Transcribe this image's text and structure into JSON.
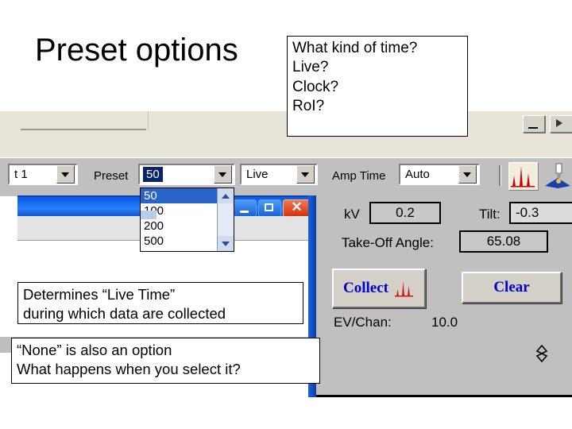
{
  "slide": {
    "title": "Preset options"
  },
  "callouts": {
    "time_question": {
      "lines": [
        "What kind of time?",
        "Live?",
        "Clock?",
        "RoI?"
      ]
    },
    "live_time": {
      "lines": [
        "Determines “Live Time”",
        " during which data are collected"
      ]
    },
    "none_option": {
      "lines": [
        "“None” is also an option",
        "What happens when you select it?"
      ]
    }
  },
  "app": {
    "toolbar": {
      "set_combo_value": "t 1",
      "preset_label": "Preset",
      "preset_value": "50",
      "time_mode_value": "Live",
      "amp_time_label": "Amp Time",
      "amp_time_value": "Auto",
      "spectrum_icon": "spectrum-icon",
      "probe_icon": "probe-icon"
    },
    "preset_dropdown": {
      "options": [
        "50",
        "100",
        "200",
        "500"
      ],
      "selected": "50"
    },
    "window_controls": {
      "minimize": "minimize-icon",
      "maximize": "maximize-icon",
      "close": "close-icon"
    },
    "settings_panel": {
      "kv_label": "kV",
      "kv_value": "0.2",
      "tilt_label": "Tilt:",
      "tilt_value": "-0.3",
      "take_off_angle_label": "Take-Off Angle:",
      "take_off_angle_value": "65.08",
      "collect_label": "Collect",
      "clear_label": "Clear",
      "ev_chan_label": "EV/Chan:",
      "ev_chan_value": "10.0"
    }
  },
  "colors": {
    "title_bar_blue": "#1267f0",
    "close_red": "#d2330e",
    "selection_blue": "#2a63c8",
    "panel_gray": "#c0c0c0",
    "cream": "#e8e4d8",
    "button_text_blue": "#0000cc",
    "spectrum_red": "#cc0000"
  }
}
